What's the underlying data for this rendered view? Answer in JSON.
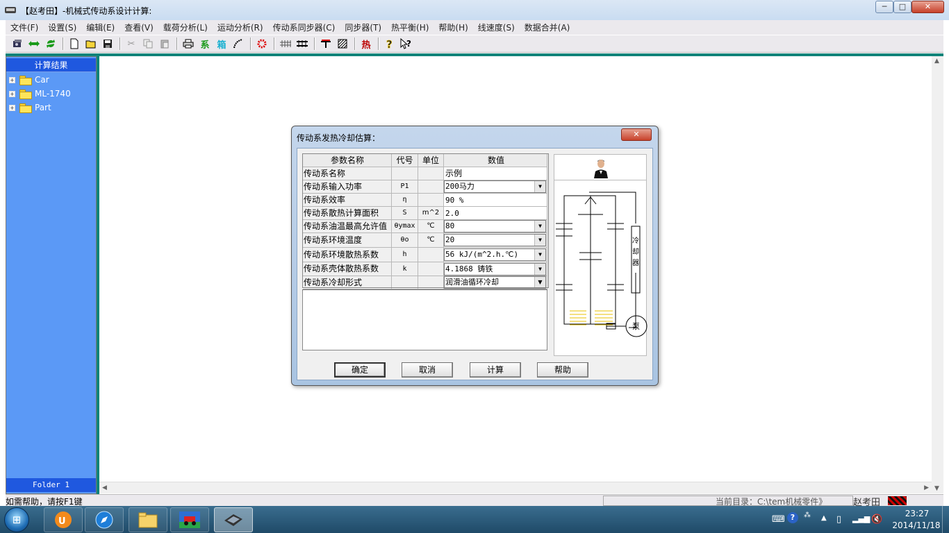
{
  "window": {
    "title": "【赵考田】-机械式传动系设计计算:",
    "controls": {
      "minimize": "─",
      "maximize": "□",
      "close": "✕"
    }
  },
  "menu": [
    "文件(F)",
    "设置(S)",
    "编辑(E)",
    "查看(V)",
    "载荷分析(L)",
    "运动分析(R)",
    "传动系同步器(C)",
    "同步器(T)",
    "热平衡(H)",
    "帮助(H)",
    "线速度(S)",
    "数据合并(A)"
  ],
  "toolbar": {
    "icons": [
      "db-icon",
      "swap-icon",
      "refresh-icon",
      "new-file-icon",
      "open-folder-icon",
      "save-icon",
      "cut-icon",
      "copy-icon",
      "paste-icon",
      "print-icon",
      "system-icon",
      "box-icon",
      "curve-icon",
      "gear-icon",
      "grid-icon",
      "grid-double-icon",
      "axis-icon",
      "hatch-icon",
      "heat-icon",
      "help-icon",
      "context-help-icon"
    ],
    "glyph_system": "系",
    "glyph_box": "箱",
    "glyph_heat": "热"
  },
  "left_panel": {
    "header": "计算结果",
    "tree": [
      {
        "label": "Car"
      },
      {
        "label": "ML-1740"
      },
      {
        "label": "Part"
      }
    ],
    "footer": "Folder 1"
  },
  "status_bar": {
    "help_text": "如需帮助，请按F1键",
    "current_dir": "当前目录：C:\\tem机械零件》",
    "user": "赵考田"
  },
  "dialog": {
    "title": "传动系发热冷却估算：",
    "close": "✕",
    "columns": [
      "参数名称",
      "代号",
      "单位",
      "数值"
    ],
    "rows": [
      {
        "name": "传动系名称",
        "code": "",
        "unit": "",
        "value": "示例",
        "combo": false
      },
      {
        "name": "传动系输入功率",
        "code": "P1",
        "unit": "",
        "value": "200马力",
        "combo": true
      },
      {
        "name": "传动系效率",
        "code": "η",
        "unit": "",
        "value": "90 %",
        "combo": false
      },
      {
        "name": "传动系散热计算面积",
        "code": "S",
        "unit": "m^2",
        "value": "2.0",
        "combo": false
      },
      {
        "name": "传动系油温最高允许值",
        "code": "θymax",
        "unit": "℃",
        "value": "80",
        "combo": true
      },
      {
        "name": "传动系环境温度",
        "code": "θo",
        "unit": "℃",
        "value": "20",
        "combo": true
      },
      {
        "name": "传动系环境散热系数",
        "code": "h",
        "unit": "",
        "value": "56 kJ/(m^2.h.℃)",
        "combo": true
      },
      {
        "name": "传动系壳体散热系数",
        "code": "k",
        "unit": "",
        "value": "4.1868 铸铁",
        "combo": true
      },
      {
        "name": "传动系冷却形式",
        "code": "",
        "unit": "",
        "value": "润滑油循环冷却",
        "combo": true
      }
    ],
    "diagram": {
      "cooler_label": "冷却器",
      "pump_label": "泵"
    },
    "buttons": {
      "ok": "确定",
      "cancel": "取消",
      "calculate": "计算",
      "help": "帮助"
    }
  },
  "taskbar": {
    "start": "⊞",
    "time": "23:27",
    "date": "2014/11/18"
  },
  "colors": {
    "panel_blue": "#5b99f6",
    "header_blue": "#1f58df",
    "teal": "#0e8379"
  }
}
